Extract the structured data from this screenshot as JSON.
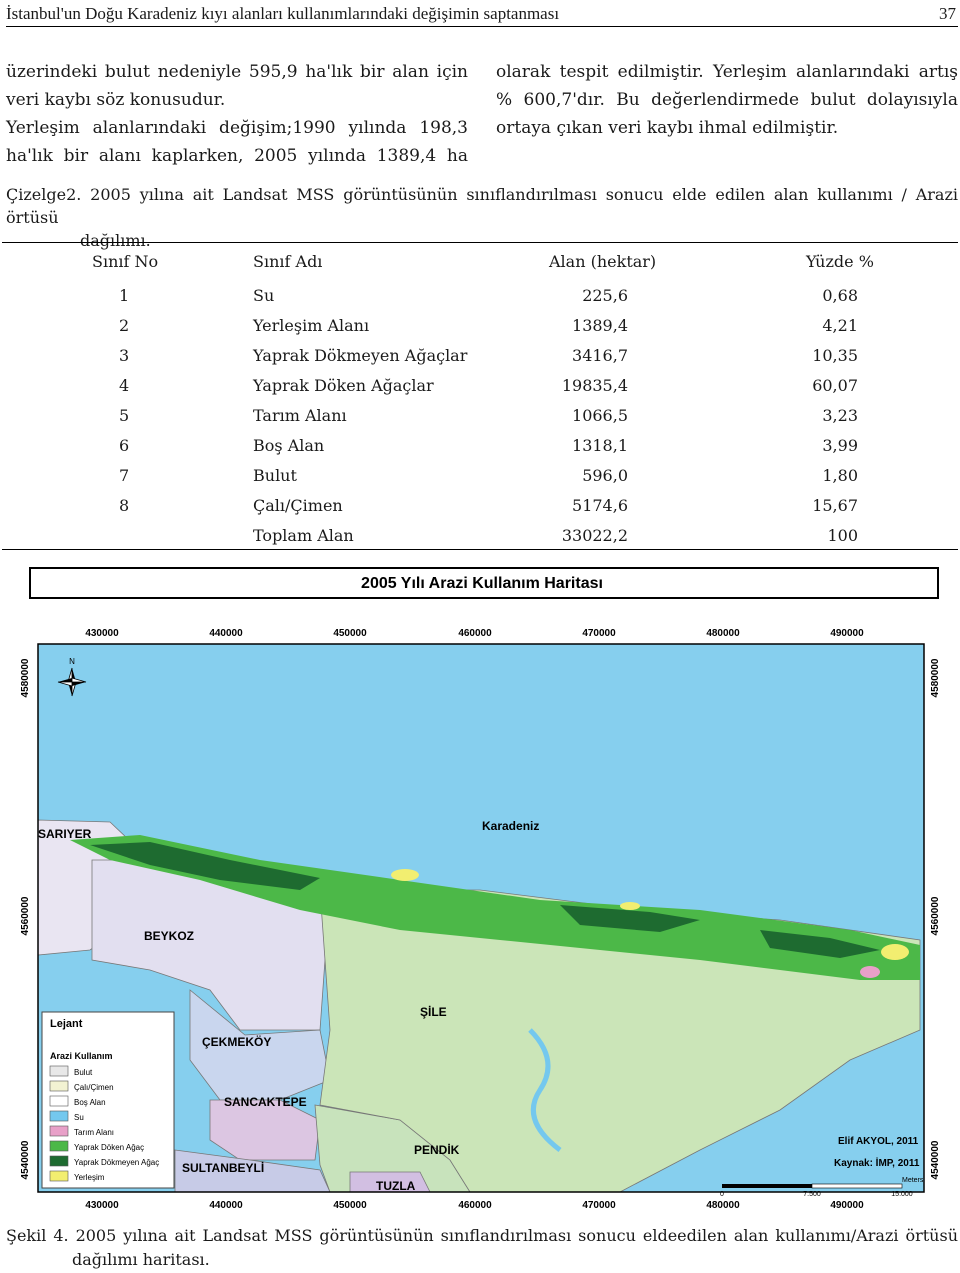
{
  "header": {
    "title": "İstanbul'un Doğu Karadeniz kıyı alanları kullanımlarındaki değişimin saptanması",
    "page_number": "37"
  },
  "body_left": [
    "üzerindeki bulut nedeniyle 595,9 ha'lık bir alan için",
    "veri kaybı söz konusudur.",
    "Yerleşim alanlarındaki değişim;1990 yılında 198,3",
    "ha'lık bir alanı kaplarken, 2005 yılında 1389,4 ha"
  ],
  "body_right": [
    "olarak tespit edilmiştir. Yerleşim alanlarındaki artış",
    "% 600,7'dır. Bu değerlendirmede bulut dolayısıyla",
    "ortaya çıkan veri kaybı ihmal edilmiştir."
  ],
  "table_caption_line1": "Çizelge2. 2005 yılına ait Landsat MSS görüntüsünün sınıflandırılması sonucu elde edilen alan kullanımı / Arazi örtüsü",
  "table_caption_line2": "dağılımı.",
  "table": {
    "headers": [
      "Sınıf No",
      "Sınıf Adı",
      "Alan (hektar)",
      "Yüzde %"
    ],
    "rows": [
      {
        "no": "1",
        "name": "Su",
        "area": "225,6",
        "pct": "0,68"
      },
      {
        "no": "2",
        "name": "Yerleşim Alanı",
        "area": "1389,4",
        "pct": "4,21"
      },
      {
        "no": "3",
        "name": "Yaprak Dökmeyen Ağaçlar",
        "area": "3416,7",
        "pct": "10,35"
      },
      {
        "no": "4",
        "name": "Yaprak Döken Ağaçlar",
        "area": "19835,4",
        "pct": "60,07"
      },
      {
        "no": "5",
        "name": "Tarım Alanı",
        "area": "1066,5",
        "pct": "3,23"
      },
      {
        "no": "6",
        "name": "Boş Alan",
        "area": "1318,1",
        "pct": "3,99"
      },
      {
        "no": "7",
        "name": "Bulut",
        "area": "596,0",
        "pct": "1,80"
      },
      {
        "no": "8",
        "name": "Çalı/Çimen",
        "area": "5174,6",
        "pct": "15,67"
      }
    ],
    "total": {
      "name": "Toplam Alan",
      "area": "33022,2",
      "pct": "100"
    }
  },
  "map": {
    "title": "2005 Yılı Arazi Kullanım Haritası",
    "x_ticks": [
      "430000",
      "440000",
      "450000",
      "460000",
      "470000",
      "480000",
      "490000"
    ],
    "y_ticks": [
      "4580000",
      "4560000",
      "4540000"
    ],
    "places": {
      "sariyer": "SARIYER",
      "karadeniz": "Karadeniz",
      "beykoz": "BEYKOZ",
      "sile": "ŞİLE",
      "cekmekoy": "ÇEKMEKÖY",
      "sancaktepe": "SANCAKTEPE",
      "pendik": "PENDİK",
      "sultanbeyli": "SULTANBEYLİ",
      "tuzla": "TUZLA"
    },
    "legend": {
      "title": "Lejant",
      "subtitle": "Arazi Kullanım",
      "items": [
        {
          "label": "Bulut",
          "color": "#e8e8e8"
        },
        {
          "label": "Çalı/Çimen",
          "color": "#f2f2d2"
        },
        {
          "label": "Boş Alan",
          "color": "#ffffff"
        },
        {
          "label": "Su",
          "color": "#74c8ee"
        },
        {
          "label": "Tarım Alanı",
          "color": "#e8a0c8"
        },
        {
          "label": "Yaprak Döken Ağaç",
          "color": "#4cb848"
        },
        {
          "label": "Yaprak Dökmeyen Ağaç",
          "color": "#1e6b30"
        },
        {
          "label": "Yerleşim",
          "color": "#f2ee70"
        }
      ]
    },
    "credit": "Elif AKYOL, 2011",
    "source": "Kaynak: İMP, 2011",
    "scale_labels": [
      "0",
      "7.500",
      "15.000"
    ],
    "scale_unit": "Meters",
    "north": "N"
  },
  "figure_caption_line1": "Şekil 4. 2005 yılına ait Landsat MSS görüntüsünün sınıflandırılması sonucu eldeedilen alan kullanımı/Arazi örtüsü",
  "figure_caption_line2": "dağılımı haritası.",
  "colors": {
    "sea": "#86cfee",
    "forest_deciduous": "#4cb848",
    "forest_evergreen": "#1e6b30",
    "settlement": "#f2ee70",
    "beykoz": "#e2dff0",
    "cekmekoy": "#c9d6ee",
    "sancaktepe": "#dcc6e2",
    "sultanbeyli": "#c7cbe7",
    "pendik": "#c8e3bc",
    "tuzla": "#d2bfe2",
    "sile": "#cbe5b8"
  }
}
